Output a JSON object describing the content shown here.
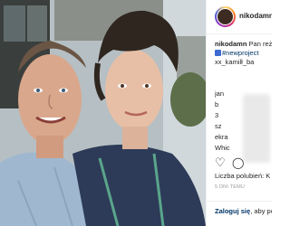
{
  "post": {
    "username": "nikodamn",
    "caption_prefix": "Pan reż",
    "hashtag": "#newproject",
    "caption_line3": "xx_kamilł_ba",
    "likes_label": "Liczba polubień: K",
    "time_ago": "5 DNI TEMU",
    "login_label": "Zaloguj się",
    "login_suffix": ", aby po"
  },
  "comments": [
    "jan",
    "b",
    "3",
    "sz",
    "ekra",
    "Whic"
  ],
  "icons": [
    "heart-icon",
    "comment-icon"
  ]
}
